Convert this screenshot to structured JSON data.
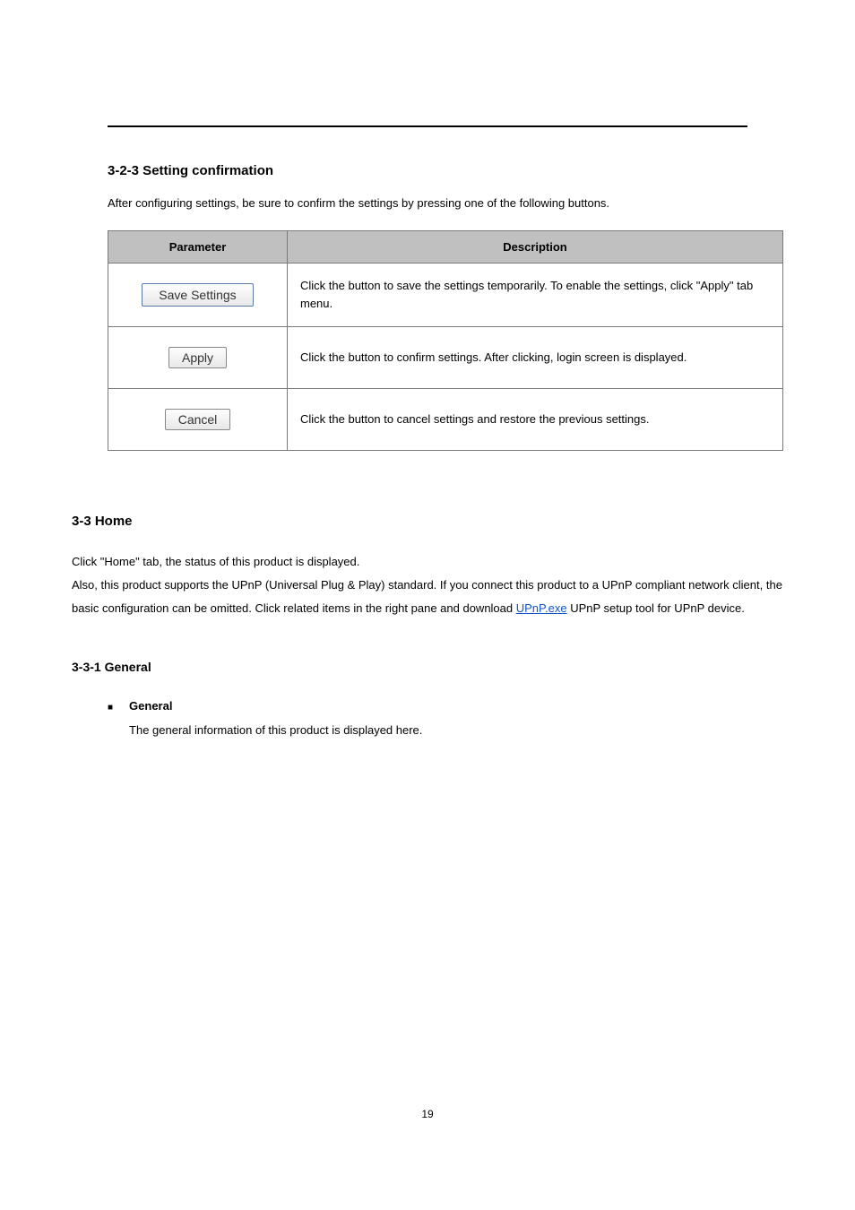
{
  "section": {
    "divider_label": "",
    "title": "3-2-3 Setting confirmation",
    "desc": "After configuring settings, be sure to confirm the settings by pressing one of the following buttons.",
    "table": {
      "headers": [
        "Parameter",
        "Description"
      ],
      "rows": [
        {
          "button_label": "Save Settings",
          "button_class": "wide",
          "desc": "Click the button to save the settings temporarily. To enable the settings, click \"Apply\" tab menu."
        },
        {
          "button_label": "Apply",
          "button_class": "narrow gray-border",
          "desc": "Click the button to confirm settings. After clicking, login screen is displayed."
        },
        {
          "button_label": "Cancel",
          "button_class": "narrow gray-border",
          "desc": "Click the button to cancel settings and restore the previous settings."
        }
      ]
    }
  },
  "chapter": {
    "heading": "3-3 Home",
    "body_pre": "Click \"Home\" tab, the status of this product is displayed.\nAlso, this product supports the UPnP (Universal Plug & Play) standard. If you connect this product to a UPnP compliant network client, the basic configuration can be omitted. Click related items in the right pane and download ",
    "link_text": "UPnP.exe",
    "body_post": " UPnP setup tool for UPnP device.",
    "sub_heading": "3-3-1 General",
    "bullet": {
      "label": "General",
      "desc": "The general information of this product is displayed here."
    }
  },
  "page_number": "19"
}
